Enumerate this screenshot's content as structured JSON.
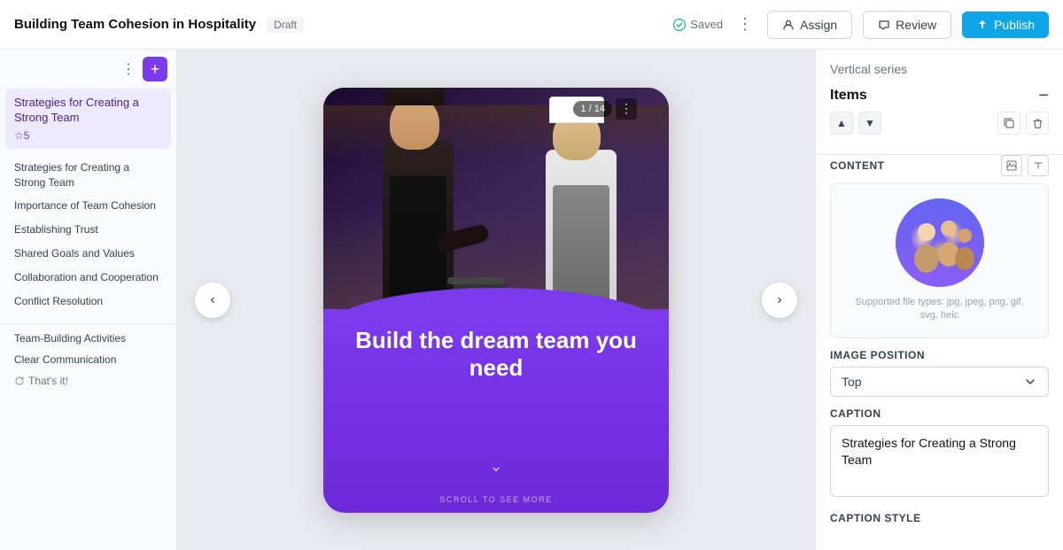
{
  "header": {
    "title": "Building Team Cohesion in Hospitality",
    "draft_label": "Draft",
    "saved_label": "Saved",
    "assign_label": "Assign",
    "review_label": "Review",
    "publish_label": "Publish"
  },
  "sidebar": {
    "active_item": "Strategies for Creating a Strong Team",
    "active_stars": "☆5",
    "items": [
      {
        "label": "Strategies for Creating a Strong Team"
      },
      {
        "label": "Importance of Team Cohesion"
      },
      {
        "label": "Establishing Trust"
      },
      {
        "label": "Shared Goals and Values"
      },
      {
        "label": "Collaboration and Cooperation"
      },
      {
        "label": "Conflict Resolution"
      }
    ],
    "bottom_items": [
      {
        "label": "Team-Building Activities"
      },
      {
        "label": "Clear Communication"
      }
    ],
    "footer_label": "That's it!"
  },
  "slide": {
    "counter": "1 / 14",
    "headline": "Build the dream team you need",
    "scroll_label": "SCROLL TO SEE MORE"
  },
  "right_panel": {
    "section_title": "Vertical series",
    "items_title": "Items",
    "content_label": "CONTENT",
    "file_types": "Supported file types: jpg, jpeg, png, gif, svg, heic",
    "image_position_label": "IMAGE POSITION",
    "position_value": "Top",
    "caption_label": "CAPTION",
    "caption_value": "Strategies for Creating a Strong Team",
    "caption_style_label": "CAPTION STYLE"
  }
}
